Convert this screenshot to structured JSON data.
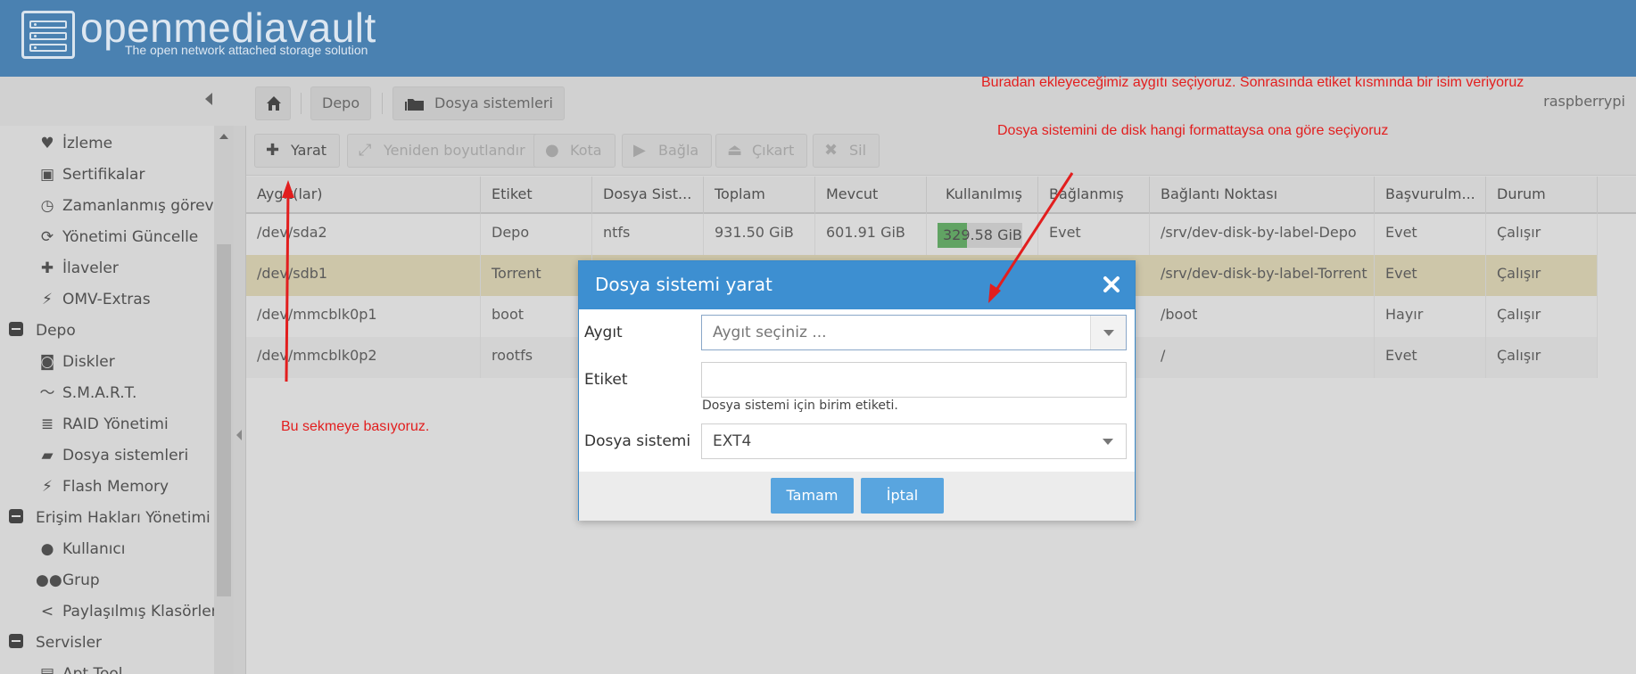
{
  "header": {
    "logo_text": "openmediavault",
    "logo_subtitle": "The open network attached storage solution"
  },
  "breadcrumb": {
    "items": [
      "Depo",
      "Dosya sistemleri"
    ],
    "hostname": "raspberrypi"
  },
  "sidebar": {
    "items": [
      {
        "label": "İzleme",
        "icon": "heartbeat-icon"
      },
      {
        "label": "Sertifikalar",
        "icon": "certificate-icon"
      },
      {
        "label": "Zamanlanmış görevler",
        "icon": "calendar-clock-icon"
      },
      {
        "label": "Yönetimi Güncelle",
        "icon": "refresh-icon"
      },
      {
        "label": "İlaveler",
        "icon": "puzzle-icon"
      },
      {
        "label": "OMV-Extras",
        "icon": "plug-icon"
      }
    ],
    "groups": [
      {
        "label": "Depo",
        "items": [
          {
            "label": "Diskler",
            "icon": "disk-icon"
          },
          {
            "label": "S.M.A.R.T.",
            "icon": "pulse-icon"
          },
          {
            "label": "RAID Yönetimi",
            "icon": "database-icon"
          },
          {
            "label": "Dosya sistemleri",
            "icon": "folder-icon"
          },
          {
            "label": "Flash Memory",
            "icon": "flash-icon"
          }
        ]
      },
      {
        "label": "Erişim Hakları Yönetimi",
        "items": [
          {
            "label": "Kullanıcı",
            "icon": "user-icon"
          },
          {
            "label": "Grup",
            "icon": "users-icon"
          },
          {
            "label": "Paylaşılmış Klasörler",
            "icon": "share-icon"
          }
        ]
      },
      {
        "label": "Servisler",
        "items": [
          {
            "label": "Apt Tool",
            "icon": "apt-icon"
          }
        ]
      }
    ]
  },
  "toolbar": {
    "create": "Yarat",
    "resize": "Yeniden boyutlandır",
    "quota": "Kota",
    "mount": "Bağla",
    "unmount": "Çıkart",
    "delete": "Sil"
  },
  "grid": {
    "columns": [
      "Aygıt(lar)",
      "Etiket",
      "Dosya Sist...",
      "Toplam",
      "Mevcut",
      "Kullanılmış",
      "Bağlanmış",
      "Bağlantı Noktası",
      "Başvurulm...",
      "Durum"
    ],
    "rows": [
      {
        "device": "/dev/sda2",
        "label": "Depo",
        "fs": "ntfs",
        "total": "931.50 GiB",
        "available": "601.91 GiB",
        "used": "329.58 GiB",
        "used_fraction": 0.35,
        "mounted": "Evet",
        "mountpoint": "/srv/dev-disk-by-label-Depo",
        "referenced": "Evet",
        "status": "Çalışır"
      },
      {
        "device": "/dev/sdb1",
        "label": "Torrent",
        "fs": "",
        "total": "",
        "available": "",
        "used": "",
        "mounted": "",
        "mountpoint": "/srv/dev-disk-by-label-Torrent",
        "referenced": "Evet",
        "status": "Çalışır"
      },
      {
        "device": "/dev/mmcblk0p1",
        "label": "boot",
        "fs": "",
        "total": "",
        "available": "",
        "used": "",
        "mounted": "",
        "mountpoint": "/boot",
        "referenced": "Hayır",
        "status": "Çalışır"
      },
      {
        "device": "/dev/mmcblk0p2",
        "label": "rootfs",
        "fs": "",
        "total": "",
        "available": "",
        "used": "",
        "mounted": "",
        "mountpoint": "/",
        "referenced": "Evet",
        "status": "Çalışır"
      }
    ]
  },
  "dialog": {
    "title": "Dosya sistemi yarat",
    "device_label": "Aygıt",
    "device_placeholder": "Aygıt seçiniz ...",
    "tag_label": "Etiket",
    "tag_value": "",
    "tag_help": "Dosya sistemi için birim etiketi.",
    "fs_label": "Dosya sistemi",
    "fs_value": "EXT4",
    "ok": "Tamam",
    "cancel": "İptal"
  },
  "annotations": {
    "top1": "Buradan ekleyeceğimiz aygıtı seçiyoruz. Sonrasında etiket kısmında bir isim veriyoruz",
    "top2": "Dosya sistemini de disk hangi formattaysa ona göre seçiyoruz",
    "left": "Bu sekmeye basıyoruz."
  },
  "colors": {
    "header_bg": "#4a81b1",
    "dialog_title_bg": "#3d8fd1",
    "button_bg": "#59a5df",
    "selected_row_bg": "#eee3b8",
    "usage_fill": "#4caf50",
    "annotation": "#e21e1e"
  }
}
